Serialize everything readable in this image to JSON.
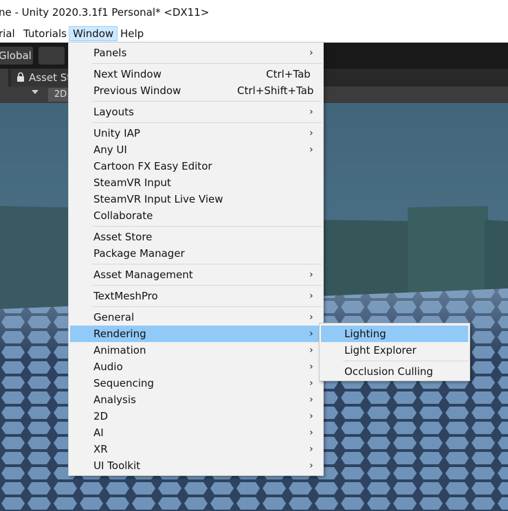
{
  "window": {
    "title": "ne - Unity 2020.3.1f1 Personal* <DX11>"
  },
  "menubar": {
    "items": [
      "rial",
      "Tutorials",
      "Window",
      "Help"
    ]
  },
  "toolbar": {
    "global_label": "Global"
  },
  "tabs": {
    "asset_store_label": "Asset St"
  },
  "scene_view": {
    "mode_2d_label": "2D"
  },
  "window_menu": {
    "items": [
      {
        "label": "Panels",
        "submenu": true
      },
      {
        "label": "Next Window",
        "shortcut": "Ctrl+Tab"
      },
      {
        "label": "Previous Window",
        "shortcut": "Ctrl+Shift+Tab"
      },
      {
        "label": "Layouts",
        "submenu": true
      },
      {
        "label": "Unity IAP",
        "submenu": true
      },
      {
        "label": "Any UI",
        "submenu": true
      },
      {
        "label": "Cartoon FX Easy Editor"
      },
      {
        "label": "SteamVR Input"
      },
      {
        "label": "SteamVR Input Live View"
      },
      {
        "label": "Collaborate"
      },
      {
        "label": "Asset Store"
      },
      {
        "label": "Package Manager"
      },
      {
        "label": "Asset Management",
        "submenu": true
      },
      {
        "label": "TextMeshPro",
        "submenu": true
      },
      {
        "label": "General",
        "submenu": true
      },
      {
        "label": "Rendering",
        "submenu": true,
        "highlighted": true
      },
      {
        "label": "Animation",
        "submenu": true
      },
      {
        "label": "Audio",
        "submenu": true
      },
      {
        "label": "Sequencing",
        "submenu": true
      },
      {
        "label": "Analysis",
        "submenu": true
      },
      {
        "label": "2D",
        "submenu": true
      },
      {
        "label": "AI",
        "submenu": true
      },
      {
        "label": "XR",
        "submenu": true
      },
      {
        "label": "UI Toolkit",
        "submenu": true
      }
    ],
    "arrow_glyph": "›"
  },
  "rendering_submenu": {
    "items": [
      {
        "label": "Lighting",
        "highlighted": true
      },
      {
        "label": "Light Explorer"
      },
      {
        "label": "Occlusion Culling"
      }
    ]
  },
  "colors": {
    "menu_bg": "#f2f2f2",
    "menu_highlight": "#91c9f7",
    "menubar_active": "#cde8ff",
    "toolbar_bg": "#191919",
    "scene_sky": "#4a6e80",
    "scene_walls": "#37585c",
    "scene_floor": "#6d8fb4"
  },
  "icons": {
    "grid_snap": "grid-snap-icon",
    "lock": "lock-icon",
    "dropdown": "triangle-down-icon",
    "submenu": "chevron-right-icon"
  }
}
